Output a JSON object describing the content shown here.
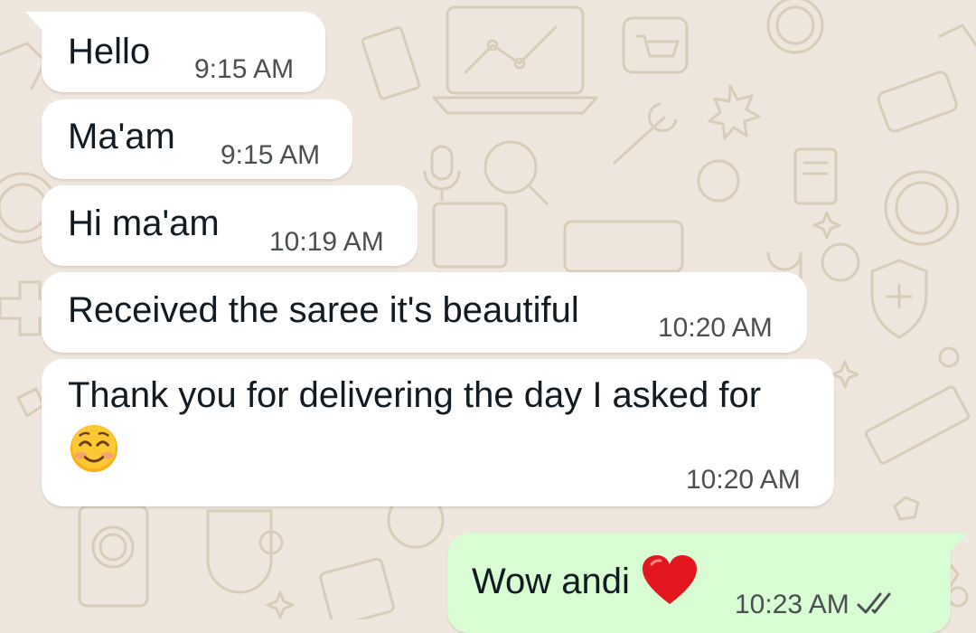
{
  "theme": {
    "wallpaper": "#efe7dd",
    "doodle": "#d9cdb9",
    "incoming_bubble": "#ffffff",
    "outgoing_bubble": "#d9fdd3",
    "text": "#111b21",
    "time": "#4a4f52",
    "read_ticks": "#4a4f52"
  },
  "messages": [
    {
      "direction": "incoming",
      "text": "Hello",
      "time": "9:15 AM"
    },
    {
      "direction": "incoming",
      "text": "Ma'am",
      "time": "9:15 AM"
    },
    {
      "direction": "incoming",
      "text": "Hi ma'am",
      "time": "10:19 AM"
    },
    {
      "direction": "incoming",
      "text": "Received the saree it's beautiful",
      "time": "10:20 AM"
    },
    {
      "direction": "incoming",
      "text": "Thank you for delivering the day I asked for",
      "emoji": "smiling-face-with-smiling-eyes",
      "time": "10:20 AM"
    },
    {
      "direction": "outgoing",
      "text": "Wow andi",
      "emoji": "red-heart",
      "time": "10:23 AM",
      "status": "read-double-check"
    }
  ]
}
